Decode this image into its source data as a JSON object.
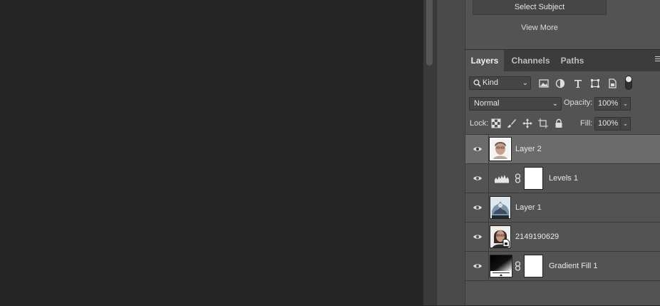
{
  "panel": {
    "select_subject": "Select Subject",
    "view_more": "View More"
  },
  "tabs": [
    "Layers",
    "Channels",
    "Paths"
  ],
  "active_tab": "Layers",
  "filter": {
    "kind": "Kind",
    "icons": [
      "image-filter-icon",
      "adjustment-filter-icon",
      "type-filter-icon",
      "shape-filter-icon",
      "smart-object-filter-icon",
      "filter-toggle-icon"
    ]
  },
  "blend": {
    "mode": "Normal",
    "opacity_label": "Opacity:",
    "opacity": "100%",
    "fill_label": "Fill:",
    "fill": "100%"
  },
  "lock": {
    "label": "Lock:",
    "icons": [
      "lock-transparent-pixels-icon",
      "lock-image-pixels-icon",
      "lock-position-icon",
      "lock-artboard-icon",
      "lock-all-icon"
    ]
  },
  "layers": [
    {
      "name": "Layer 2",
      "selected": true,
      "thumb": "portrait"
    },
    {
      "name": "Levels 1",
      "selected": false,
      "thumb": "levels-adjustment"
    },
    {
      "name": "Layer 1",
      "selected": false,
      "thumb": "texture"
    },
    {
      "name": "2149190629",
      "selected": false,
      "thumb": "portrait-smart-object"
    },
    {
      "name": "Gradient Fill 1",
      "selected": false,
      "thumb": "gradient"
    }
  ],
  "colors": {
    "canvas": "#262626",
    "panel": "#535353",
    "selected_row": "#6b6b6b",
    "tab_bar": "#3c3c3c"
  }
}
